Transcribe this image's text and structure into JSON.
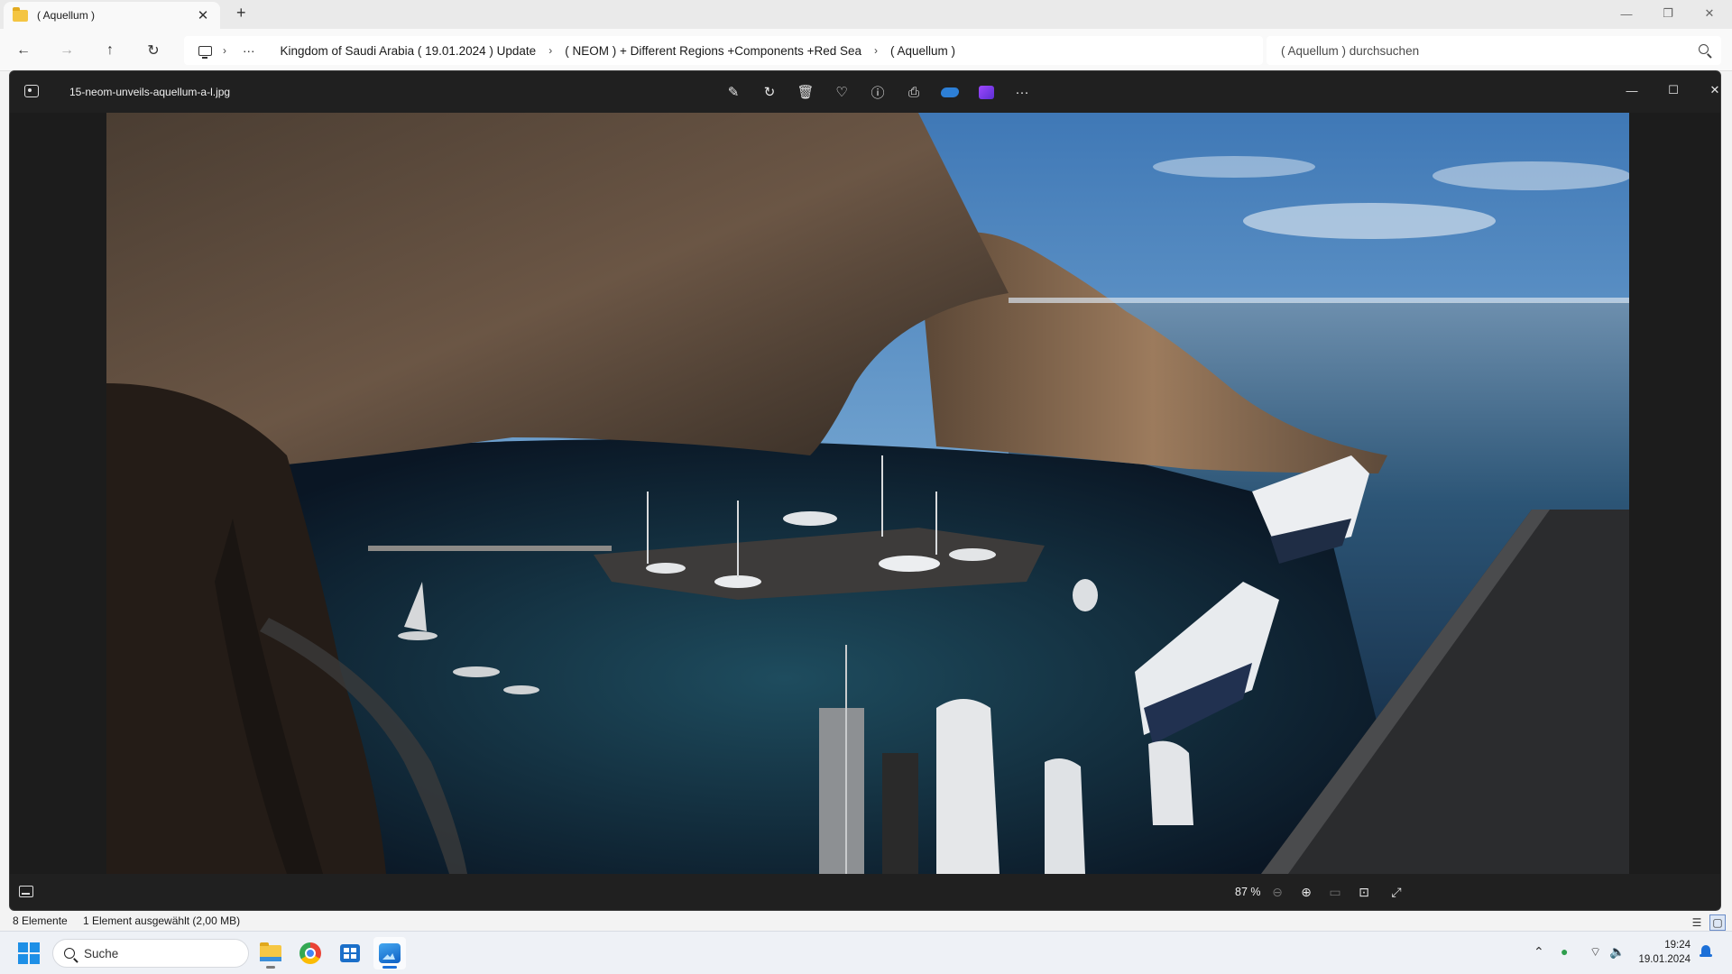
{
  "explorer": {
    "tab_title": "( Aquellum )",
    "breadcrumbs": [
      "Kingdom of Saudi Arabia ( 19.01.2024 ) Update",
      "( NEOM ) + Different Regions +Components +Red Sea",
      "( Aquellum )"
    ],
    "search_placeholder": "( Aquellum ) durchsuchen",
    "status": {
      "item_count": "8 Elemente",
      "selection": "1 Element ausgewählt (2,00 MB)"
    }
  },
  "viewer": {
    "filename": "15-neom-unveils-aquellum-a-l.jpg",
    "zoom": "87 %",
    "toolbar": [
      "edit-image",
      "rotate",
      "delete",
      "favorite",
      "file-info",
      "print",
      "onedrive",
      "clipchamp",
      "more"
    ],
    "image_description_icon": "photo"
  },
  "taskbar": {
    "search_placeholder": "Suche",
    "apps": [
      "file-explorer",
      "chrome",
      "microsoft-store",
      "photos"
    ],
    "clock_time": "19:24",
    "clock_date": "19.01.2024"
  },
  "colors": {
    "accent": "#1c70d8",
    "viewer_bg": "#1c1c1c",
    "chrome_bg": "#f3f3f3"
  }
}
